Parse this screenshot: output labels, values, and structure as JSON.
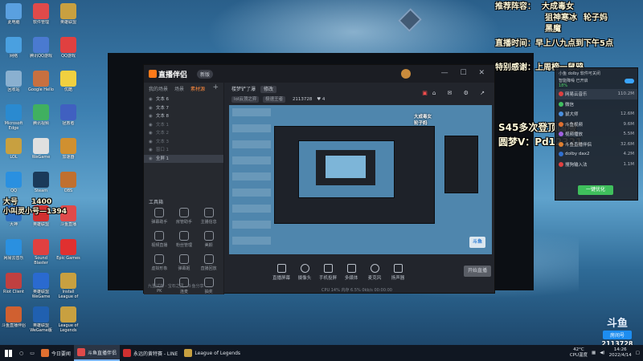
{
  "desktop": {
    "icons": [
      {
        "label": "此电脑",
        "color": "#5aa0e0"
      },
      {
        "label": "软件管理",
        "color": "#e04a4a"
      },
      {
        "label": "英雄联盟",
        "color": "#c8a040"
      },
      {
        "label": "网络",
        "color": "#4aa0e0"
      },
      {
        "label": "腾讯QQ游戏",
        "color": "#4a7ad0"
      },
      {
        "label": "QQ游戏",
        "color": "#e04040"
      },
      {
        "label": "回收站",
        "color": "#8ab0d0"
      },
      {
        "label": "Google Hello",
        "color": "#c87040"
      },
      {
        "label": "优酷",
        "color": "#f0d040"
      },
      {
        "label": "Microsoft Edge",
        "color": "#2a8ad0"
      },
      {
        "label": "腾讯视频",
        "color": "#40b060"
      },
      {
        "label": "拯救者",
        "color": "#4060c0"
      },
      {
        "label": "LOL",
        "color": "#c8a040"
      },
      {
        "label": "WeGame",
        "color": "#e0e0e0"
      },
      {
        "label": "加速器",
        "color": "#d09030"
      },
      {
        "label": "QQ",
        "color": "#2a90e0"
      },
      {
        "label": "Steam",
        "color": "#1a3a5a"
      },
      {
        "label": "OBS",
        "color": "#c07030"
      },
      {
        "label": "大神",
        "color": "#3070c0"
      },
      {
        "label": "英雄联盟",
        "color": "#d03030"
      },
      {
        "label": "斗鱼直播",
        "color": "#e04a4a"
      },
      {
        "label": "网易云音乐",
        "color": "#2a90e0"
      },
      {
        "label": "Sound Blaster",
        "color": "#e04040"
      },
      {
        "label": "Epic Games",
        "color": "#e03030"
      },
      {
        "label": "Riot Client",
        "color": "#c04040"
      },
      {
        "label": "英雄联盟WeGame",
        "color": "#2a6ad0"
      },
      {
        "label": "Install League of Legends",
        "color": "#c8a040"
      },
      {
        "label": "斗鱼直播伴侣",
        "color": "#d06030"
      },
      {
        "label": "英雄联盟WeGame版",
        "color": "#2060b0"
      },
      {
        "label": "League of Legends",
        "color": "#c8a040"
      }
    ]
  },
  "overlay": {
    "recommend_title": "推荐阵容：",
    "recommend_1": "大成毒女",
    "recommend_2": "狙神寒冰",
    "recommend_3": "轮子妈",
    "recommend_4": "黑魔",
    "schedule": "直播时间：早上八九点到下午5点",
    "thanks": "特别感谢：上周榜一鼠鸦",
    "left_line1": "大号",
    "left_line1_num": "1400",
    "left_line2": "小叫灵小号—1394",
    "center_line1": "S45多次登顶国服",
    "center_line2": "圆梦V：Pd12321"
  },
  "app": {
    "name": "直播伴侣",
    "version": "新版",
    "tabs": [
      "我的场景",
      "场景",
      "素材源"
    ],
    "scenes": [
      {
        "label": "文本 6",
        "dim": false
      },
      {
        "label": "文本 7",
        "dim": false
      },
      {
        "label": "文本 8",
        "dim": false
      },
      {
        "label": "文本 1",
        "dim": true
      },
      {
        "label": "文本 2",
        "dim": true
      },
      {
        "label": "文本 3",
        "dim": true
      },
      {
        "label": "窗口 1",
        "dim": true
      },
      {
        "label": "全屏 1",
        "dim": false
      }
    ],
    "tools_label": "工具箱",
    "tools": [
      "弹幕助手",
      "房管助手",
      "主播信息",
      "视频直播",
      "粉丝管理",
      "美颜",
      "虚拟形象",
      "弹幕姬",
      "直播回放",
      "PK",
      "连麦",
      "抽奖"
    ],
    "room_title": "楼梦铲了瀑",
    "room_chip": "修改",
    "room_tag1": "lol云顶之弈",
    "room_tag2": "极速王者",
    "room_num": "2113728",
    "room_likes": "4",
    "toolbar": [
      {
        "label": "直播屏幕",
        "round": false
      },
      {
        "label": "摄像头",
        "round": true
      },
      {
        "label": "手机投屏",
        "round": false
      },
      {
        "label": "多媒体",
        "round": false
      },
      {
        "label": "麦克风",
        "round": true
      },
      {
        "label": "扬声器",
        "round": false
      }
    ],
    "start_label": "开始直播",
    "status_text": "CPU 14%  内存 6.5%  0kb/s  00:00:00",
    "left_status": "九重试炼 · 宝石之灵 · 斗鱼分享"
  },
  "player": {
    "header_name": "小鱼 dolby 软件可关闭",
    "header_sub": "智能降噪 已开启",
    "header_pct": "18%",
    "rows": [
      {
        "label": "网易云音乐",
        "value": "110.2M",
        "color": "#e04040"
      },
      {
        "label": "微信",
        "value": "",
        "color": "#40c060"
      },
      {
        "label": "鼠大师",
        "value": "12.6M",
        "color": "#4a90e0"
      },
      {
        "label": "斗鱼视频",
        "value": "9.6M",
        "color": "#e07030"
      },
      {
        "label": "视频播放",
        "value": "5.5M",
        "color": "#a060e0"
      },
      {
        "label": "斗鱼直播伴侣",
        "value": "32.6M",
        "color": "#e08030"
      },
      {
        "label": "dolby dax2",
        "value": "4.2M",
        "color": "#3070d0"
      },
      {
        "label": "搜狗输入法",
        "value": "1.1M",
        "color": "#e04040"
      }
    ],
    "button_label": "一键优化"
  },
  "watermark": {
    "logo": "斗鱼",
    "sub": "房间号",
    "room": "2113728"
  },
  "taskbar": {
    "items": [
      {
        "label": "今日要闻",
        "color": "#e07030",
        "active": false
      },
      {
        "label": "斗鱼直播伴侣",
        "color": "#e04a4a",
        "active": true
      },
      {
        "label": "永远的黄特赛 - LINE",
        "color": "#d03030",
        "active": false
      },
      {
        "label": "League of Legends",
        "color": "#c8a040",
        "active": false
      }
    ],
    "temp": "42°C",
    "temp_sub": "CPU温度",
    "time": "14:26",
    "date": "2022/4/14"
  }
}
